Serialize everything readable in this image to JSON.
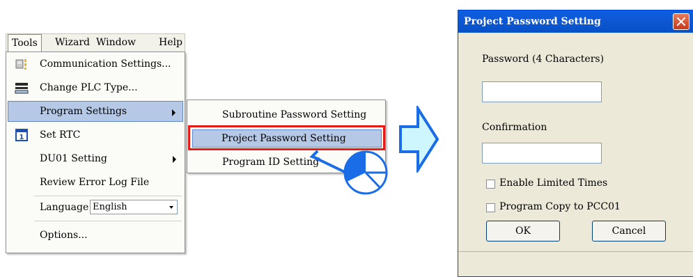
{
  "menubar": {
    "items": [
      {
        "label": "Tools"
      },
      {
        "label": "Wizard"
      },
      {
        "label": "Window"
      },
      {
        "label": "Help"
      }
    ]
  },
  "tools_menu": {
    "items": [
      {
        "label": "Communication Settings...",
        "icon": "communication-icon"
      },
      {
        "label": "Change PLC Type...",
        "icon": "plc-type-icon"
      },
      {
        "label": "Program Settings",
        "submenu": true
      },
      {
        "label": "Set RTC",
        "icon": "calendar-icon"
      },
      {
        "label": "DU01 Setting",
        "submenu": true
      },
      {
        "label": "Review Error Log File"
      },
      {
        "label": "Language",
        "value": "English"
      },
      {
        "label": "Options..."
      }
    ]
  },
  "submenu": {
    "items": [
      {
        "label": "Subroutine Password Setting"
      },
      {
        "label": "Project Password Setting"
      },
      {
        "label": "Program ID Setting"
      }
    ]
  },
  "dialog": {
    "title": "Project Password Setting",
    "password_label": "Password (4 Characters)",
    "password_value": "",
    "confirmation_label": "Confirmation",
    "confirmation_value": "",
    "enable_limited_times_label": "Enable Limited Times",
    "enable_limited_times_checked": false,
    "program_copy_label": "Program Copy to PCC01",
    "program_copy_checked": false,
    "ok_label": "OK",
    "cancel_label": "Cancel"
  },
  "colors": {
    "highlight": "#b5c8e6",
    "red_frame": "#e41b17",
    "arrow_fill": "#cdf6ff",
    "arrow_stroke": "#1a6de6",
    "titlebar": "#0a5fe0"
  }
}
